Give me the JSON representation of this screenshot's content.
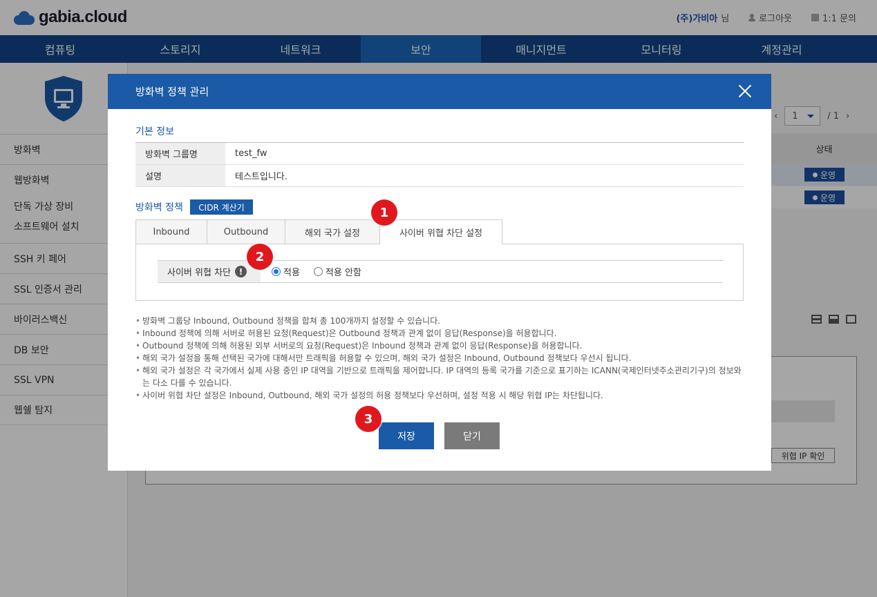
{
  "header": {
    "logo_text": "gabia.cloud",
    "company": "(주)가비아",
    "company_suffix": "님",
    "logout": "로그아웃",
    "support": "1:1 문의"
  },
  "nav": {
    "items": [
      "컴퓨팅",
      "스토리지",
      "네트워크",
      "보안",
      "매니지먼트",
      "모니터링",
      "계정관리"
    ],
    "active": "보안"
  },
  "sidebar": {
    "items": [
      {
        "label": "방화벽"
      },
      {
        "label": "웹방화벽",
        "sub": [
          "단독 가상 장비",
          "소프트웨어 설치"
        ]
      },
      {
        "label": "SSH 키 페어"
      },
      {
        "label": "SSL 인증서 관리"
      },
      {
        "label": "바이러스백신"
      },
      {
        "label": "DB 보안"
      },
      {
        "label": "SSL VPN"
      },
      {
        "label": "웹쉘 탐지"
      }
    ]
  },
  "background": {
    "pager_page": "1",
    "pager_total": "/ 1",
    "status_header": "상태",
    "status_rows": [
      "운영",
      "운영"
    ],
    "threat_ip_button": "위협 IP 확인"
  },
  "modal": {
    "title": "방화벽 정책 관리",
    "basic_info_title": "기본 정보",
    "fields": [
      {
        "label": "방화벽 그룹명",
        "value": "test_fw"
      },
      {
        "label": "설명",
        "value": "테스트입니다."
      }
    ],
    "policy_title": "방화벽 정책",
    "cidr_button": "CIDR 계산기",
    "tabs": [
      "Inbound",
      "Outbound",
      "해외 국가 설정",
      "사이버 위협 차단 설정"
    ],
    "active_tab": "사이버 위협 차단 설정",
    "cyber_label": "사이버 위협 차단",
    "radio_apply": "적용",
    "radio_not_apply": "적용 안함",
    "selected_radio": "적용",
    "notes": [
      "방화벽 그룹당 Inbound, Outbound 정책을 합쳐 총 100개까지 설정할 수 있습니다.",
      "Inbound 정책에 의해 서버로 허용된 요청(Request)은 Outbound 정책과 관계 없이 응답(Response)을 허용합니다.",
      "Outbound 정책에 의해 허용된 외부 서버로의 요청(Request)은 Inbound 정책과 관계 없이 응답(Response)을 허용합니다.",
      "해외 국가 설정을 통해 선택된 국가에 대해서만 트래픽을 허용할 수 있으며, 해외 국가 설정은 Inbound, Outbound 정책보다 우선시 됩니다.",
      "해외 국가 설정은 각 국가에서 실제 사용 중인 IP 대역을 기반으로 트래픽을 제어합니다. IP 대역의 등록 국가를 기준으로 표기하는 ICANN(국제인터넷주소관리기구)의 정보와는 다소 다를 수 있습니다.",
      "사이버 위협 차단 설정은 Inbound, Outbound, 해외 국가 설정의 허용 정책보다 우선하며, 설정 적용 시 해당 위협 IP는 차단됩니다."
    ],
    "save_button": "저장",
    "close_button": "닫기"
  },
  "markers": [
    "1",
    "2",
    "3"
  ],
  "colors": {
    "nav_bg": "#114489",
    "nav_active": "#1b67b8",
    "modal_header": "#1b5aa6",
    "marker": "#e0181e"
  }
}
